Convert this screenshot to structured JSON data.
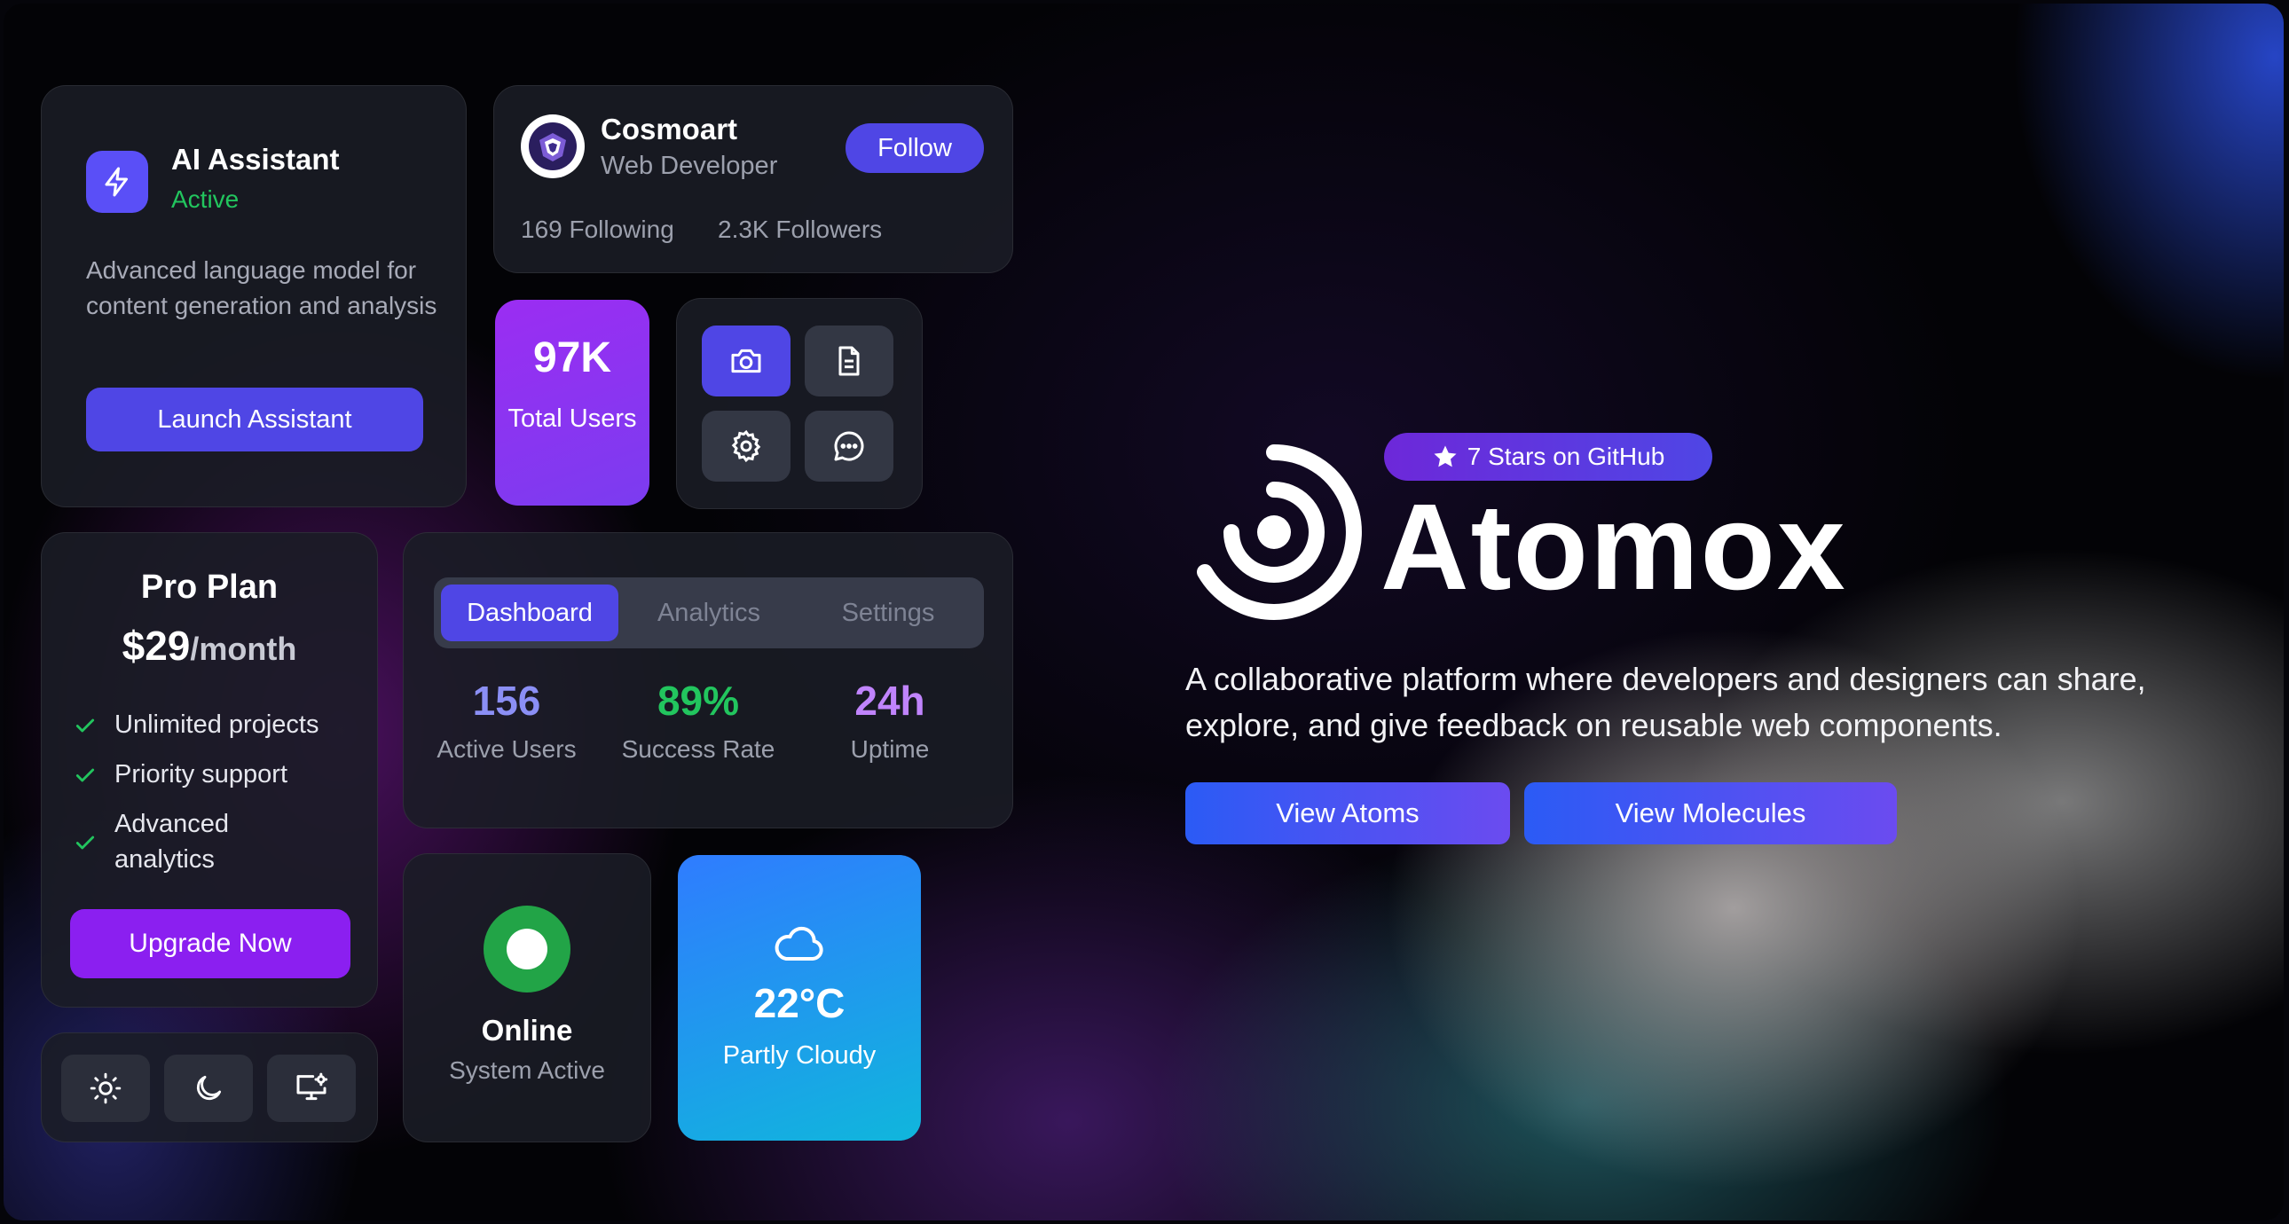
{
  "ai_card": {
    "title": "AI Assistant",
    "status": "Active",
    "description": "Advanced language model for content generation and analysis",
    "button_label": "Launch Assistant",
    "icon": "lightning-icon"
  },
  "profile": {
    "name": "Cosmoart",
    "role": "Web Developer",
    "follow_label": "Follow",
    "following": "169 Following",
    "followers": "2.3K Followers"
  },
  "users_stat": {
    "value": "97K",
    "label": "Total Users"
  },
  "icon_grid": [
    "camera-icon",
    "document-icon",
    "settings-icon",
    "chat-icon"
  ],
  "plan": {
    "title": "Pro Plan",
    "price": "$29",
    "period": "/month",
    "features": [
      "Unlimited projects",
      "Priority support",
      "Advanced analytics"
    ],
    "button_label": "Upgrade Now"
  },
  "theme_switcher": [
    "sun-icon",
    "moon-icon",
    "monitor-settings-icon"
  ],
  "dashboard": {
    "tabs": [
      "Dashboard",
      "Analytics",
      "Settings"
    ],
    "active_tab": "Dashboard",
    "stats": [
      {
        "value": "156",
        "label": "Active Users",
        "color": "#8b8ff5"
      },
      {
        "value": "89%",
        "label": "Success Rate",
        "color": "#22c55e"
      },
      {
        "value": "24h",
        "label": "Uptime",
        "color": "#c084fc"
      }
    ]
  },
  "status": {
    "title": "Online",
    "subtitle": "System Active",
    "color": "#22a447"
  },
  "weather": {
    "temperature": "22°C",
    "condition": "Partly Cloudy",
    "icon": "cloud-icon"
  },
  "hero": {
    "badge": "7 Stars on GitHub",
    "title": "Atomox",
    "description": "A collaborative platform where developers and designers can share, explore, and give feedback on reusable web components.",
    "primary_button": "View Atoms",
    "secondary_button": "View Molecules"
  },
  "colors": {
    "accent": "#4f46e5",
    "purple": "#8b1ff0",
    "success": "#22c55e"
  }
}
